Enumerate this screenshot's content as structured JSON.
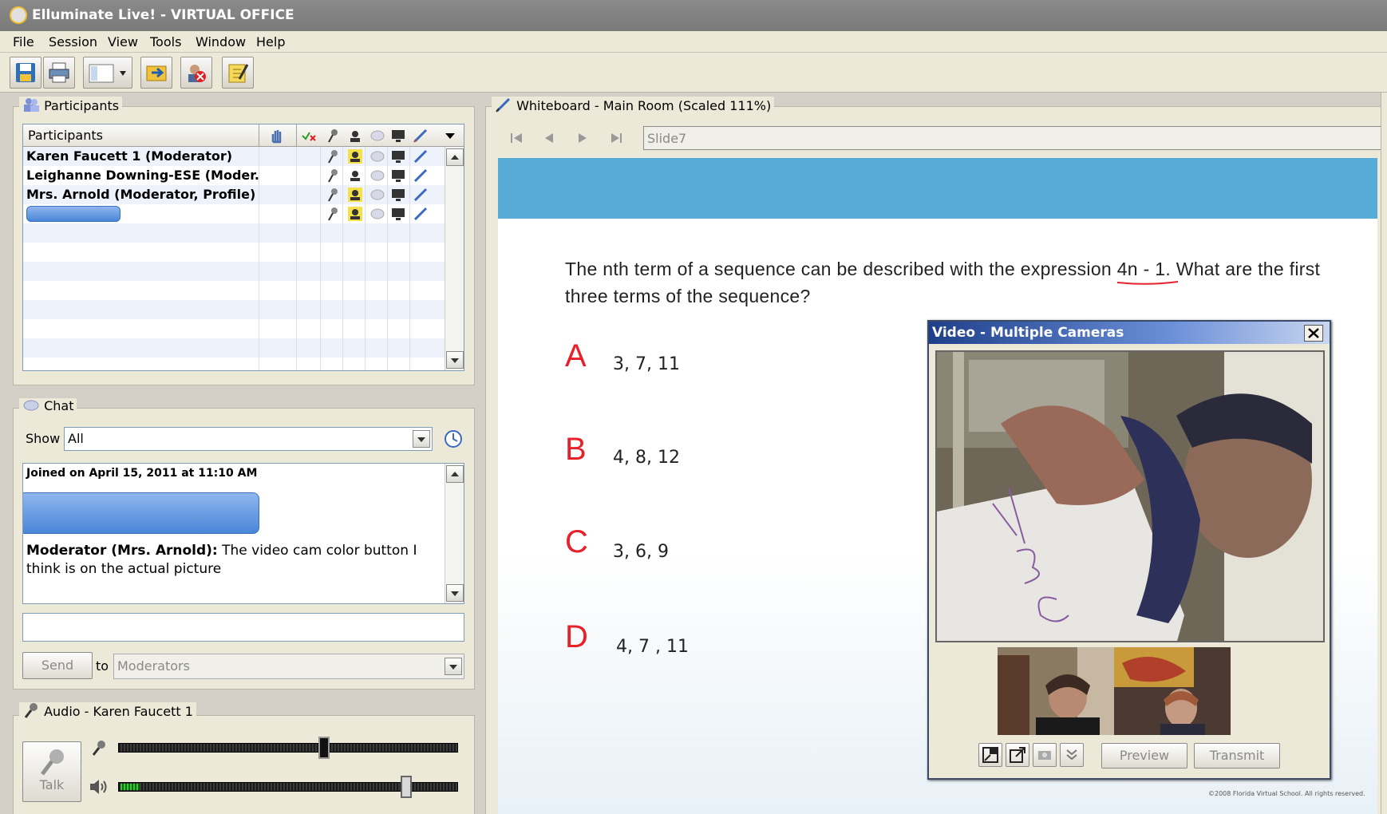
{
  "window": {
    "title": "Elluminate Live! - VIRTUAL OFFICE"
  },
  "menu": [
    "File",
    "Session",
    "View",
    "Tools",
    "Window",
    "Help"
  ],
  "participants": {
    "panel_label": "Participants",
    "column_header": "Participants",
    "rows": [
      "Karen Faucett 1 (Moderator)",
      "Leighanne Downing-ESE (Moder...",
      "Mrs. Arnold (Moderator, Profile)"
    ]
  },
  "chat": {
    "panel_label": "Chat",
    "show_label": "Show",
    "show_value": "All",
    "joined_text": "Joined on April 15, 2011 at 11:10 AM",
    "message_author": "Moderator (Mrs. Arnold):",
    "message_text": " The video cam color button I think is on the actual picture",
    "send_label": "Send",
    "to_label": "to",
    "to_value": "Moderators"
  },
  "audio": {
    "panel_label": "Audio - Karen Faucett 1",
    "talk_label": "Talk",
    "mic_level": 0.61,
    "speaker_level": 0.86
  },
  "whiteboard": {
    "panel_label": "Whiteboard - Main Room (Scaled 111%)",
    "slide_name": "Slide7",
    "question_part1": "The nth term of a sequence can be described with the expression ",
    "question_expr": "4n - 1",
    "question_part2": ". What are the first three terms of the sequence?",
    "answers": [
      {
        "letter": "A",
        "value": "3, 7, 11"
      },
      {
        "letter": "B",
        "value": "4, 8, 12"
      },
      {
        "letter": "C",
        "value": "3, 6, 9"
      },
      {
        "letter": "D",
        "value": "4, 7 , 11"
      }
    ],
    "footer": "©2008 Florida Virtual School. All rights reserved.",
    "accent_color": "#56acd6",
    "answer_color": "#e8202a"
  },
  "video": {
    "title": "Video - Multiple Cameras",
    "preview_label": "Preview",
    "transmit_label": "Transmit"
  }
}
